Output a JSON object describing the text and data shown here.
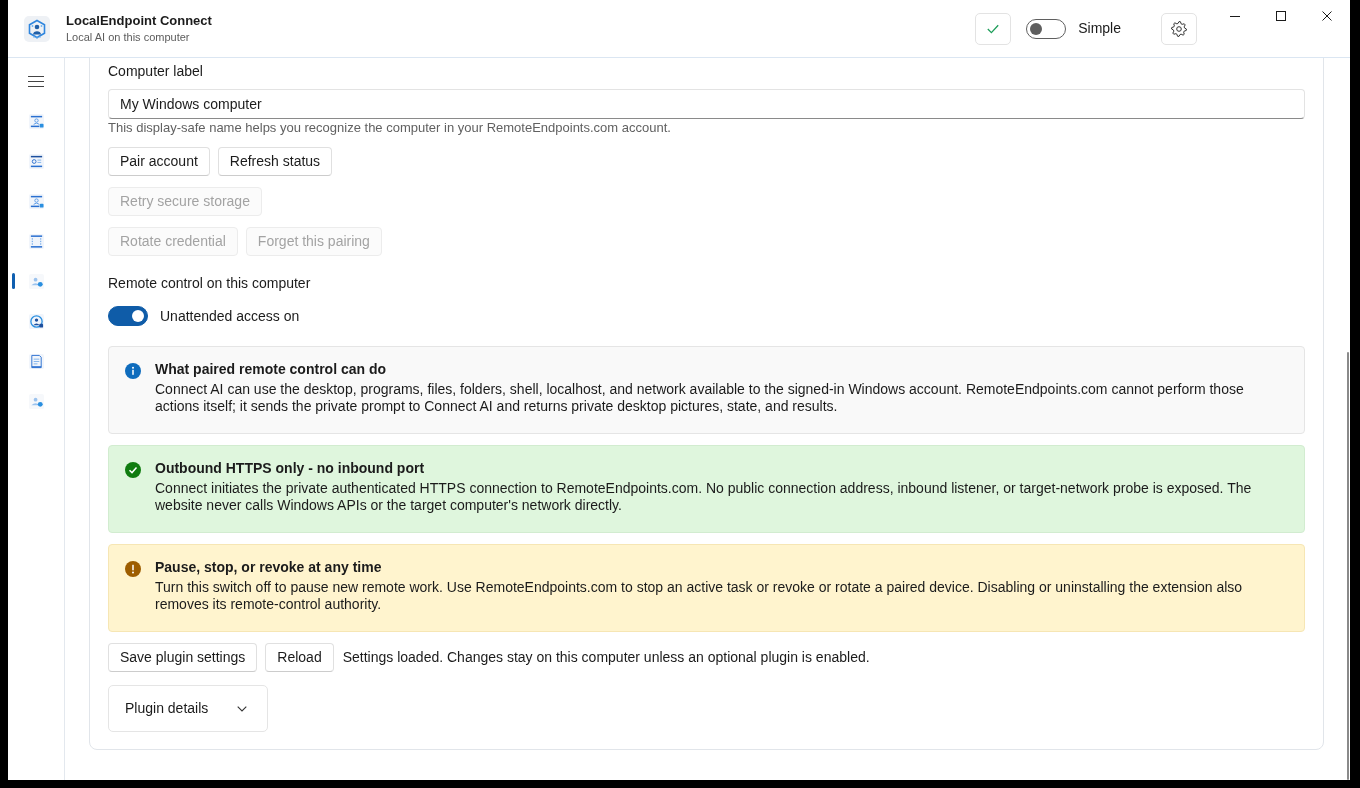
{
  "window": {
    "title": "LocalEndpoint Connect",
    "subtitle": "Local AI on this computer"
  },
  "toolbar": {
    "mode_switch": {
      "label": "Simple",
      "on": false
    }
  },
  "sidebar": {
    "items": [
      {
        "selected": false
      },
      {
        "selected": false
      },
      {
        "selected": false
      },
      {
        "selected": false
      },
      {
        "selected": true
      },
      {
        "selected": false
      },
      {
        "selected": false
      },
      {
        "selected": false
      }
    ]
  },
  "computer_label": {
    "label": "Computer label",
    "value": "My Windows computer",
    "help": "This display-safe name helps you recognize the computer in your RemoteEndpoints.com account."
  },
  "button_rows": [
    {
      "buttons": [
        {
          "label": "Pair account",
          "disabled": false
        },
        {
          "label": "Refresh status",
          "disabled": false
        }
      ]
    },
    {
      "buttons": [
        {
          "label": "Retry secure storage",
          "disabled": true
        }
      ]
    },
    {
      "buttons": [
        {
          "label": "Rotate credential",
          "disabled": true
        },
        {
          "label": "Forget this pairing",
          "disabled": true
        }
      ]
    }
  ],
  "remote_control": {
    "heading": "Remote control on this computer",
    "switch": {
      "label": "Unattended access on",
      "on": true
    }
  },
  "notices": [
    {
      "kind": "info",
      "title": "What paired remote control can do",
      "text": "Connect AI can use the desktop, programs, files, folders, shell, localhost, and network available to the signed-in Windows account. RemoteEndpoints.com cannot perform those actions itself; it sends the private prompt to Connect AI and returns private desktop pictures, state, and results."
    },
    {
      "kind": "success",
      "title": "Outbound HTTPS only - no inbound port",
      "text": "Connect initiates the private authenticated HTTPS connection to RemoteEndpoints.com. No public connection address, inbound listener, or target-network probe is exposed. The website never calls Windows APIs or the target computer's network directly."
    },
    {
      "kind": "warning",
      "title": "Pause, stop, or revoke at any time",
      "text": "Turn this switch off to pause new remote work. Use RemoteEndpoints.com to stop an active task or revoke or rotate a paired device. Disabling or uninstalling the extension also removes its remote-control authority."
    }
  ],
  "footer": {
    "buttons": [
      {
        "label": "Save plugin settings",
        "disabled": false
      },
      {
        "label": "Reload",
        "disabled": false
      }
    ],
    "status": "Settings loaded. Changes stay on this computer unless an optional plugin is enabled."
  },
  "plugin_details": {
    "label": "Plugin details",
    "expanded": false
  }
}
